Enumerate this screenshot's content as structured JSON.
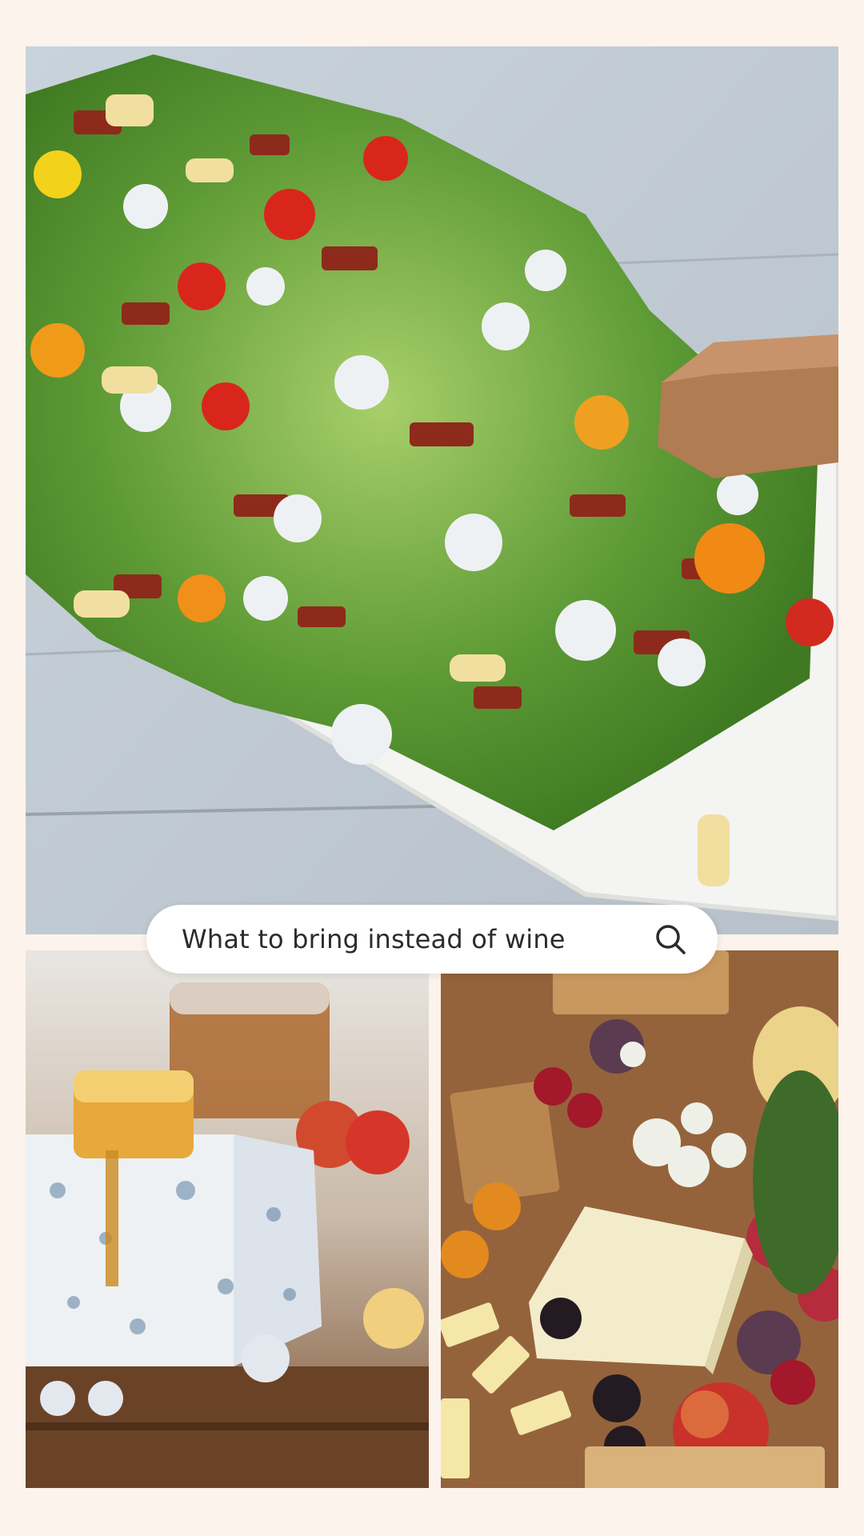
{
  "search": {
    "query": "What to bring instead of wine",
    "icon": "search-icon"
  },
  "photos": [
    {
      "name": "wedge salad with bacon, grilled corn, tomatoes and blue cheese",
      "icon": "salad-photo"
    },
    {
      "name": "blue cheese wedge with honeycomb",
      "icon": "cheese-photo"
    },
    {
      "name": "cheese board with crackers, fruit and blue cheese",
      "icon": "board-photo"
    }
  ],
  "colors": {
    "background": "#fbf3ec",
    "search_bg": "#ffffff",
    "text": "#2b2b2b"
  }
}
